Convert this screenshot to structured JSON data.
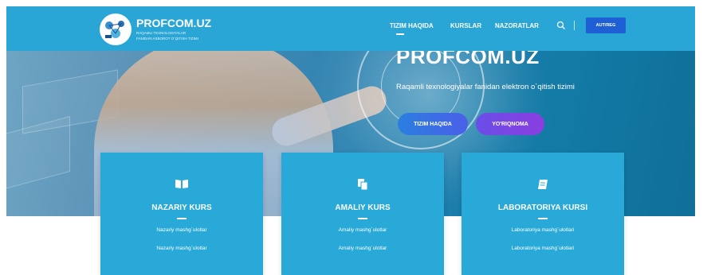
{
  "header": {
    "logo_name": "PROFCOM.UZ",
    "logo_tagline_1": "RAQAMLI TEXNOLOGIYALAR",
    "logo_tagline_2": "FANIDAN AXBOROT O`QITISH TIZIMI",
    "nav": [
      {
        "label": "TIZIM HAQIDA",
        "active": true
      },
      {
        "label": "KURSLAR"
      },
      {
        "label": "NAZORATLAR"
      }
    ],
    "search_icon": "search-icon",
    "auth_label": "AUT/REG"
  },
  "hero": {
    "title": "PROFCOM.UZ",
    "subtitle": "Raqamli texnologiyalar fanidan elektron o`qitish tizimi",
    "buttons": [
      {
        "label": "TIZIM HAQIDA"
      },
      {
        "label": "YO'RIQNOMA"
      }
    ]
  },
  "cards": [
    {
      "icon": "open-book-icon",
      "title": "NAZARIY KURS",
      "line1": "Nazariy mashg`ulotlar",
      "line2": "Nazariy mashg`ulotlar"
    },
    {
      "icon": "documents-icon",
      "title": "AMALIY KURS",
      "line1": "Amaliy mashg`ulotlar",
      "line2": "Amaliy mashg`ulotlar"
    },
    {
      "icon": "notebook-icon",
      "title": "LABORATORIYA KURSI",
      "line1": "Laboratoriya mashg`ulotlari",
      "line2": "Laboratoriya mashg`ulotlari"
    }
  ],
  "colors": {
    "header_bg": "#29a6d6",
    "card_bg": "#28a9d8",
    "auth_button": "#1e5fd6",
    "hero_button_1": "#2a7fe0",
    "hero_button_2": "#8a3ee0"
  }
}
